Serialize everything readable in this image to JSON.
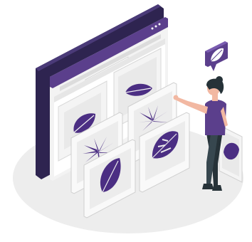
{
  "scene": {
    "kind": "isometric-illustration",
    "theme": "plant image gallery",
    "colors": {
      "accent": "#5b3f8c",
      "accent_dark": "#2e2450",
      "floor": "#ededed",
      "frame": "#f4f4f4",
      "frame_edge": "#d9d9d9",
      "leaf": "#4b2e83",
      "pants": "#263238",
      "skin": "#f2b8a2",
      "hair": "#263238"
    },
    "icons": [
      "leaf-icon",
      "speech-bubble-icon"
    ]
  }
}
